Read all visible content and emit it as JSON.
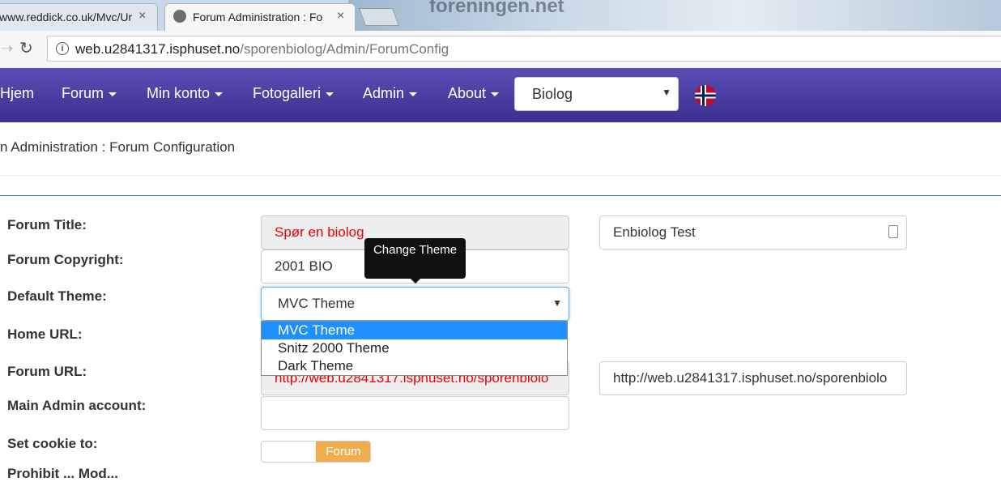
{
  "browser": {
    "tabs": [
      {
        "title": "www.reddick.co.uk/Mvc/Ur",
        "close": "×"
      },
      {
        "title": "Forum Administration : Fo",
        "close": "×"
      }
    ],
    "background_text": "foreningen.net",
    "url_host": "web.u2841317.isphuset.no",
    "url_path": "/sporenbiolog/Admin/ForumConfig"
  },
  "navbar": {
    "items": [
      {
        "label": "Hjem",
        "has_caret": false
      },
      {
        "label": "Forum",
        "has_caret": true
      },
      {
        "label": "Min konto",
        "has_caret": true
      },
      {
        "label": "Fotogalleri",
        "has_caret": true
      },
      {
        "label": "Admin",
        "has_caret": true
      },
      {
        "label": "About",
        "has_caret": true
      }
    ],
    "selected": "Biolog",
    "flag": "norway-flag"
  },
  "breadcrumb": "n Administration : Forum Configuration",
  "form": {
    "title_label": "Forum Title:",
    "title_value": "Spør en biolog",
    "title_override": "Enbiolog Test",
    "copyright_label": "Forum Copyright:",
    "copyright_value": "2001 BIO",
    "theme_label": "Default Theme:",
    "theme_value": "MVC Theme",
    "theme_tooltip": "Change Theme",
    "theme_options": [
      "MVC Theme",
      "Snitz 2000 Theme",
      "Dark Theme"
    ],
    "home_label": "Home URL:",
    "url_label": "Forum URL:",
    "url_value": "http://web.u2841317.isphuset.no/sporenbiolo",
    "url_override": "http://web.u2841317.isphuset.no/sporenbiolo",
    "admin_label": "Main Admin account:",
    "admin_value": "",
    "cookie_label": "Set cookie to:",
    "cookie_option": "Forum",
    "cut_label": "Prohibit ...  Mod..."
  },
  "colors": {
    "navbar": "#4a3fa6",
    "accent_red": "#e00000",
    "dropdown_highlight": "#1e90ff",
    "toggle": "#f0ad4e"
  }
}
